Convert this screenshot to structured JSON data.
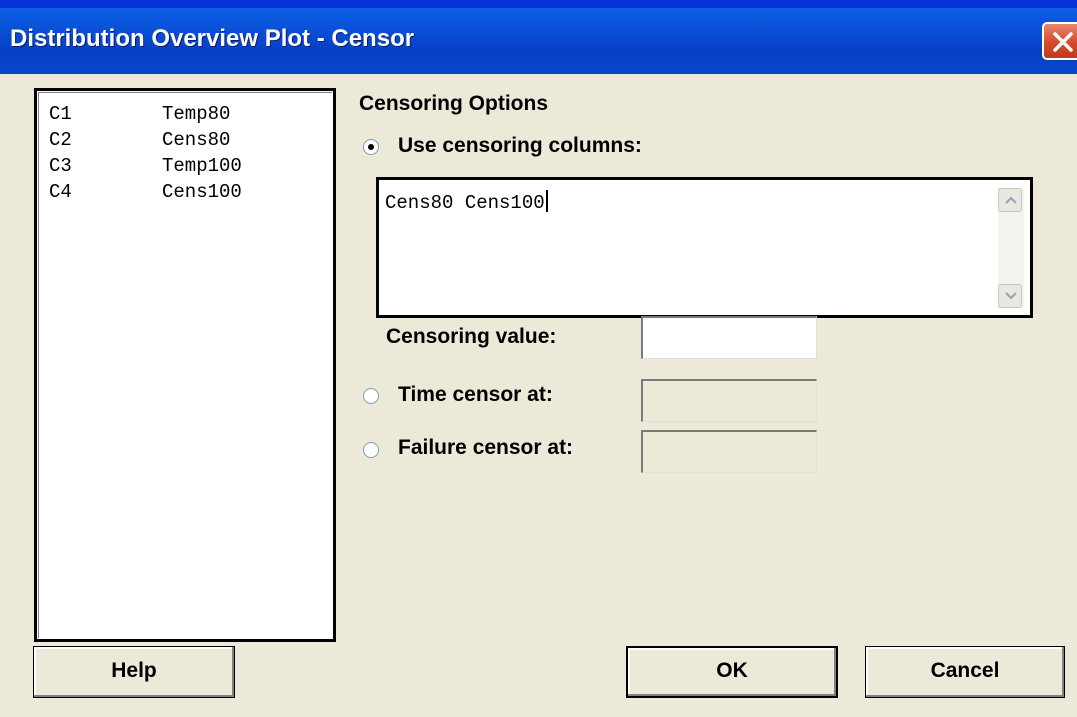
{
  "window": {
    "title": "Distribution Overview Plot - Censor"
  },
  "variables": [
    {
      "id": "C1",
      "name": "Temp80"
    },
    {
      "id": "C2",
      "name": "Cens80"
    },
    {
      "id": "C3",
      "name": "Temp100"
    },
    {
      "id": "C4",
      "name": "Cens100"
    }
  ],
  "censoring": {
    "heading": "Censoring Options",
    "use_columns_label": "Use censoring columns:",
    "columns_value": "Cens80 Cens100",
    "censoring_value_label": "Censoring value:",
    "censoring_value": "",
    "time_censor_label": "Time censor at:",
    "time_censor_value": "",
    "failure_censor_label": "Failure censor at:",
    "failure_censor_value": "",
    "selected_option": "use_columns"
  },
  "buttons": {
    "help": "Help",
    "ok": "OK",
    "cancel": "Cancel"
  },
  "colors": {
    "titlebar": "#0a4fd6",
    "dialog_bg": "#ece9d8",
    "close_button": "#d64a2c"
  },
  "icons": {
    "close": "close-icon",
    "scroll_up": "chevron-up-icon",
    "scroll_down": "chevron-down-icon"
  }
}
